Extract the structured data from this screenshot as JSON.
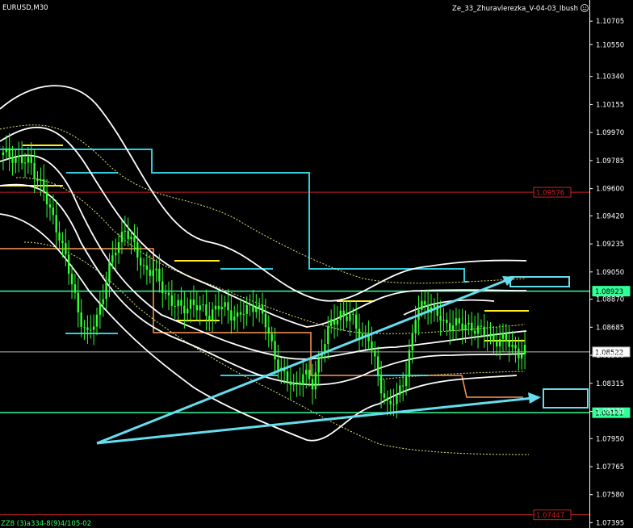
{
  "window": {
    "symbol_label": "EURUSD,M30",
    "indicator_label": "Ze_33_Zhuravlerezka_V-04-03_Ibush",
    "smiley_icon": "smiley-icon",
    "bottom_left_text": "ZZ8 (3)a334-8(9)4/105-02"
  },
  "colors": {
    "background": "#000000",
    "axis": "#ffffff",
    "candle": "#33ff33",
    "bands": "#ffffff",
    "dotted": "#e6e27a",
    "cyan_level": "#33ccdd",
    "orange_level": "#ff9955",
    "yellow_level": "#ffee22",
    "red_level": "#cc2222",
    "green_level": "#33ff99",
    "arrow": "#66ddee"
  },
  "chart_data": {
    "type": "line",
    "title": "EURUSD,M30",
    "y_ticks": [
      "1.10705",
      "1.10550",
      "1.10340",
      "1.10155",
      "1.09970",
      "1.09785",
      "1.09600",
      "1.09420",
      "1.09235",
      "1.09050",
      "1.08870",
      "1.08685",
      "1.08500",
      "1.08315",
      "1.08130",
      "1.07950",
      "1.07765",
      "1.07580",
      "1.07395"
    ],
    "ylim": [
      1.0736,
      1.1077
    ],
    "price_labels": [
      {
        "value": "1.09576",
        "color": "red"
      },
      {
        "value": "1.08923",
        "color": "green"
      },
      {
        "value": "1.08522",
        "color": "white"
      },
      {
        "value": "1.08121",
        "color": "green"
      },
      {
        "value": "1.07447",
        "color": "red"
      }
    ],
    "close_series": [
      1.0982,
      1.0982,
      1.0978,
      1.0976,
      1.0963,
      1.0945,
      1.093,
      1.0905,
      1.088,
      1.0862,
      1.0875,
      1.09,
      1.092,
      1.0935,
      1.092,
      1.0908,
      1.0905,
      1.0895,
      1.0885,
      1.088,
      1.0885,
      1.088,
      1.0878,
      1.0882,
      1.088,
      1.0875,
      1.088,
      1.0885,
      1.087,
      1.085,
      1.0835,
      1.083,
      1.0838,
      1.083,
      1.0855,
      1.087,
      1.0878,
      1.0875,
      1.0865,
      1.0862,
      1.0835,
      1.0818,
      1.082,
      1.084,
      1.0875,
      1.0885,
      1.088,
      1.087,
      1.0872,
      1.0868,
      1.087,
      1.0865,
      1.0862,
      1.086,
      1.0858,
      1.0852
    ],
    "legend": "none",
    "grid": false
  }
}
